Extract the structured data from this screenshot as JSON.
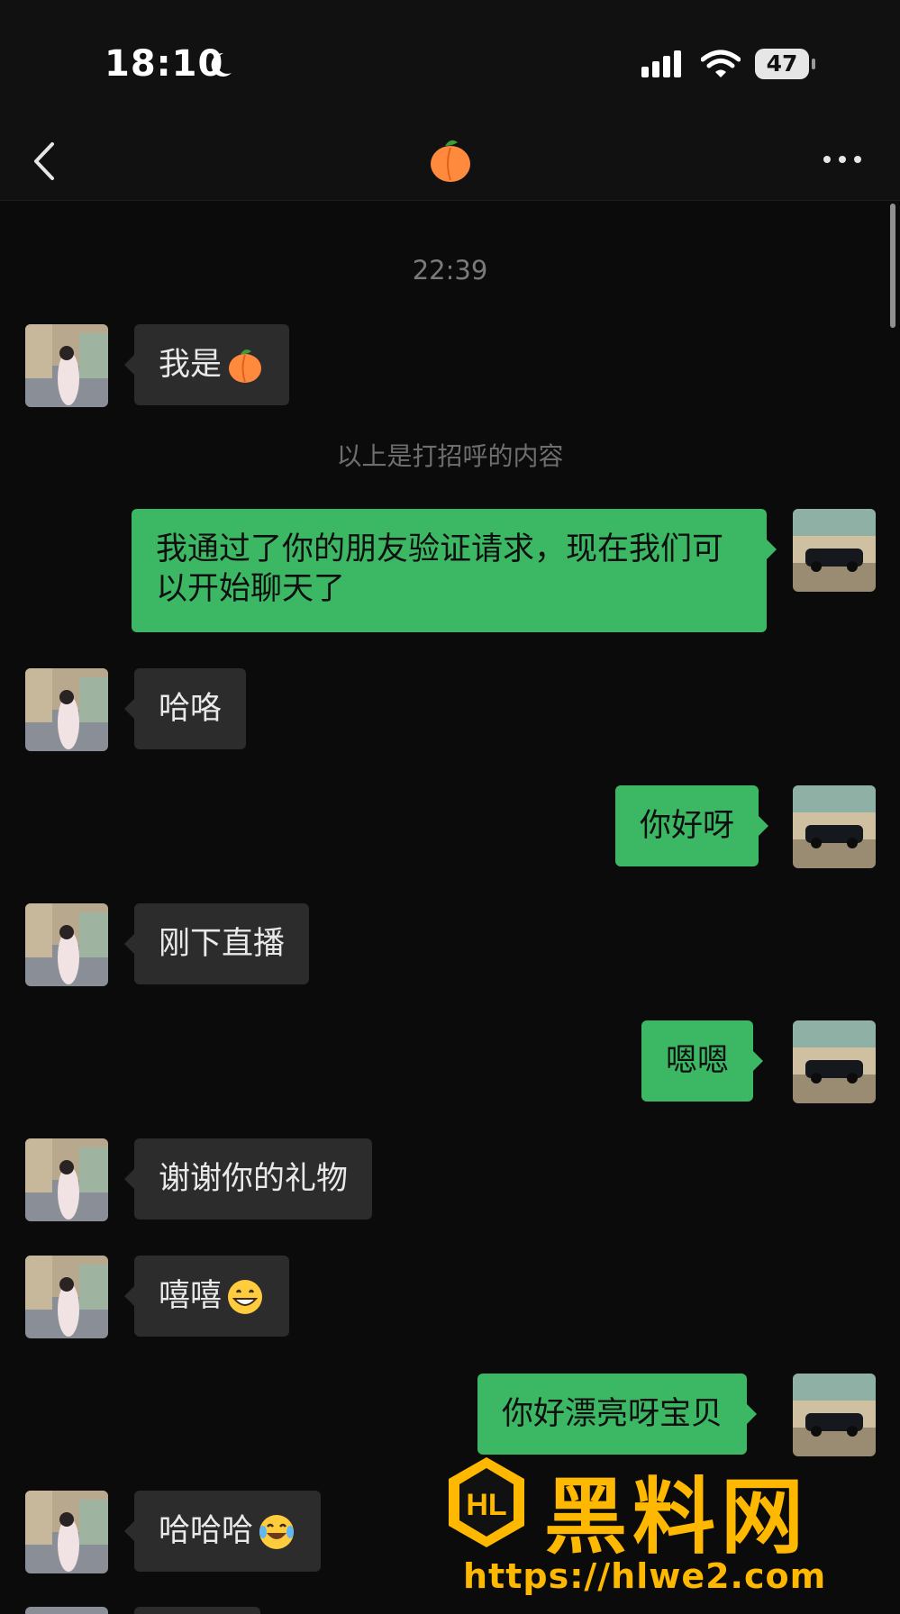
{
  "status_bar": {
    "time": "18:10",
    "battery": "47"
  },
  "nav": {
    "title_emoji": "peach-emoji"
  },
  "chat": {
    "timestamp": "22:39",
    "system_notice": "以上是打招呼的内容",
    "messages": [
      {
        "side": "in",
        "text": "我是",
        "emoji": "peach"
      },
      {
        "side": "out",
        "text": "我通过了你的朋友验证请求，现在我们可以开始聊天了"
      },
      {
        "side": "in",
        "text": "哈咯"
      },
      {
        "side": "out",
        "text": "你好呀"
      },
      {
        "side": "in",
        "text": "刚下直播"
      },
      {
        "side": "out",
        "text": "嗯嗯"
      },
      {
        "side": "in",
        "text": "谢谢你的礼物"
      },
      {
        "side": "in",
        "text": "嘻嘻",
        "emoji": "grin"
      },
      {
        "side": "out",
        "text": "你好漂亮呀宝贝"
      },
      {
        "side": "in",
        "text": "哈哈哈",
        "emoji": "tears-of-joy"
      }
    ]
  },
  "watermark": {
    "brand": "黑料网",
    "url": "https://hlwe2.com"
  },
  "colors": {
    "outgoing_bubble": "#3cb865",
    "incoming_bubble": "#2c2c2c",
    "background": "#0b0b0b",
    "watermark": "#ffb800"
  }
}
